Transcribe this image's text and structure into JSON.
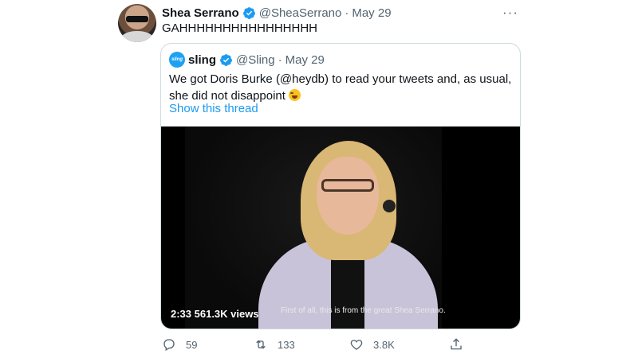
{
  "tweet": {
    "author_name": "Shea Serrano",
    "handle": "@SheaSerrano",
    "separator": "·",
    "date": "May 29",
    "text": "GAHHHHHHHHHHHHHHHH",
    "more_label": "···"
  },
  "quoted": {
    "avatar_text": "sling",
    "author_name": "sling",
    "handle": "@Sling",
    "separator": "·",
    "date": "May 29",
    "text": "We got Doris Burke (@heydb) to read your tweets and, as usual, she did not disappoint",
    "show_thread": "Show this thread",
    "video": {
      "time_views": "2:33  561.3K views",
      "caption": "First of all, this is from the great Shea Serrano."
    }
  },
  "actions": {
    "replies": "59",
    "retweets": "133",
    "likes": "3.8K"
  },
  "colors": {
    "accent": "#1d9bf0",
    "secondary_text": "#536471",
    "border": "#cfd9de"
  }
}
